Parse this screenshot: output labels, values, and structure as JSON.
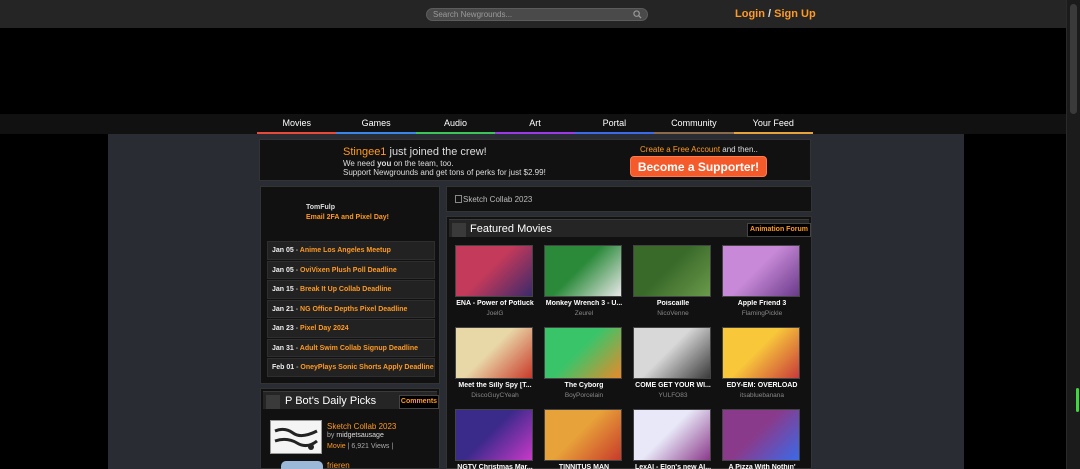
{
  "header": {
    "search_placeholder": "Search Newgrounds...",
    "login": "Login",
    "slash": "/",
    "signup": "Sign Up"
  },
  "nav": [
    {
      "label": "Movies",
      "color": "#e84a3a"
    },
    {
      "label": "Games",
      "color": "#3a86e8"
    },
    {
      "label": "Audio",
      "color": "#3ac45a"
    },
    {
      "label": "Art",
      "color": "#9a3ae8"
    },
    {
      "label": "Portal",
      "color": "#3a6ae8"
    },
    {
      "label": "Community",
      "color": "#8a6a4a"
    },
    {
      "label": "Your Feed",
      "color": "#e8a23a"
    }
  ],
  "banner": {
    "username": "Stingee1",
    "joined": " just joined the crew!",
    "need_pre": "We need ",
    "need_you": "you",
    "need_post": " on the team, too.",
    "support": "Support Newgrounds and get tons of perks for just $2.99!",
    "free_account": "Create a Free Account",
    "and_then": " and then..",
    "supporter_button": "Become a Supporter!"
  },
  "news": {
    "author": "TomFulp",
    "title": "Email 2FA and Pixel Day!"
  },
  "events": [
    {
      "date": "Jan 05",
      "title": "Anime Los Angeles Meetup"
    },
    {
      "date": "Jan 05",
      "title": "OviVixen Plush Poll Deadline"
    },
    {
      "date": "Jan 15",
      "title": "Break It Up Collab Deadline"
    },
    {
      "date": "Jan 21",
      "title": "NG Office Depths Pixel Deadline"
    },
    {
      "date": "Jan 23",
      "title": "Pixel Day 2024"
    },
    {
      "date": "Jan 31",
      "title": "Adult Swim Collab Signup Deadline"
    },
    {
      "date": "Feb 01",
      "title": "OneyPlays Sonic Shorts Apply Deadline"
    }
  ],
  "picks": {
    "header": "P Bot's Daily Picks",
    "comments": "Comments",
    "item1": {
      "title": "Sketch Collab 2023",
      "by": "by",
      "author": "midgetsausage",
      "type": "Movie",
      "views": "6,921 Views"
    },
    "item2": {
      "title": "frieren"
    }
  },
  "collab": {
    "alt": "Sketch Collab 2023"
  },
  "featured": {
    "header": "Featured Movies",
    "forum": "Animation Forum",
    "movies": [
      {
        "title": "ENA - Power of Potluck",
        "author": "JoelG",
        "c1": "#c43a5a",
        "c2": "#3a2a6a"
      },
      {
        "title": "Monkey Wrench 3 - U...",
        "author": "Zeurel",
        "c1": "#2a8a3a",
        "c2": "#e8e8e8"
      },
      {
        "title": "Poiscaille",
        "author": "NicoVenne",
        "c1": "#3a6a2a",
        "c2": "#6a9a4a"
      },
      {
        "title": "Apple Friend 3",
        "author": "FlamingPickle",
        "c1": "#c88ad8",
        "c2": "#6a3a8a"
      },
      {
        "title": "Meet the Silly Spy [T...",
        "author": "DiscoGuyCYeah",
        "c1": "#e8d8a8",
        "c2": "#c83a2a"
      },
      {
        "title": "The Cyborg",
        "author": "BoyPorcelain",
        "c1": "#3ac46a",
        "c2": "#e88a2a"
      },
      {
        "title": "COME GET YOUR WI...",
        "author": "YULFO83",
        "c1": "#d8d8d8",
        "c2": "#3a3a3a"
      },
      {
        "title": "EDY-EM: OVERLOAD",
        "author": "itsabluebanana",
        "c1": "#f8c83a",
        "c2": "#c83a3a"
      },
      {
        "title": "NGTV Christmas Mar...",
        "author": "",
        "c1": "#3a2a8a",
        "c2": "#c83ac8"
      },
      {
        "title": "TINNITUS MAN",
        "author": "",
        "c1": "#e8a23a",
        "c2": "#c83a2a"
      },
      {
        "title": "LexAI - Elon's new AI...",
        "author": "",
        "c1": "#e8e8f8",
        "c2": "#8a3a8a"
      },
      {
        "title": "A Pizza With Nothin'",
        "author": "",
        "c1": "#8a3a8a",
        "c2": "#3a6ae8"
      }
    ]
  }
}
